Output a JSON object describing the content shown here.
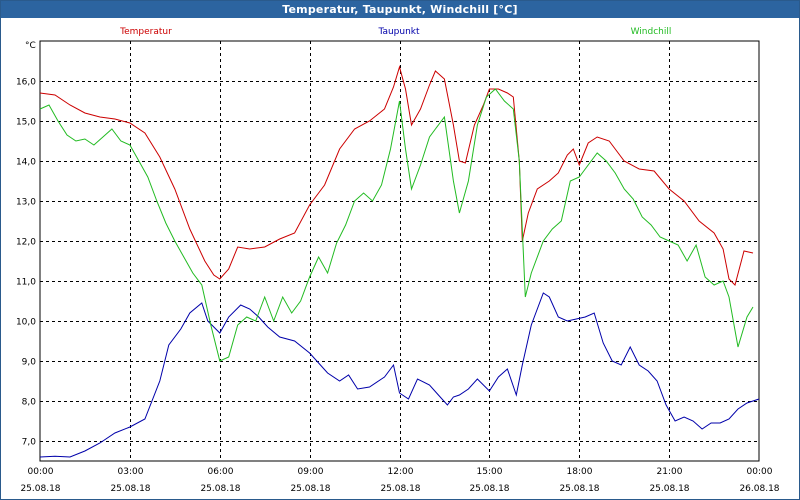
{
  "window": {
    "title": "Temperatur, Taupunkt, Windchill [°C]"
  },
  "chart_data": {
    "type": "line",
    "title": "Temperatur, Taupunkt, Windchill [°C]",
    "yunit": "°C",
    "ylim": [
      6.5,
      17.0
    ],
    "xlim": [
      0,
      24
    ],
    "grid": true,
    "y_ticks": [
      "7,0",
      "8,0",
      "9,0",
      "10,0",
      "11,0",
      "12,0",
      "13,0",
      "14,0",
      "15,0",
      "16,0"
    ],
    "y_tick_values": [
      7,
      8,
      9,
      10,
      11,
      12,
      13,
      14,
      15,
      16
    ],
    "x_ticks": [
      {
        "time": "00:00",
        "date": "25.08.18",
        "h": 0
      },
      {
        "time": "03:00",
        "date": "25.08.18",
        "h": 3
      },
      {
        "time": "06:00",
        "date": "25.08.18",
        "h": 6
      },
      {
        "time": "09:00",
        "date": "25.08.18",
        "h": 9
      },
      {
        "time": "12:00",
        "date": "25.08.18",
        "h": 12
      },
      {
        "time": "15:00",
        "date": "25.08.18",
        "h": 15
      },
      {
        "time": "18:00",
        "date": "25.08.18",
        "h": 18
      },
      {
        "time": "21:00",
        "date": "25.08.18",
        "h": 21
      },
      {
        "time": "00:00",
        "date": "26.08.18",
        "h": 24
      }
    ],
    "series": [
      {
        "name": "Temperatur",
        "color": "#cc0000",
        "points": [
          [
            0,
            15.7
          ],
          [
            0.5,
            15.65
          ],
          [
            1,
            15.4
          ],
          [
            1.5,
            15.2
          ],
          [
            2,
            15.1
          ],
          [
            2.5,
            15.05
          ],
          [
            3,
            14.95
          ],
          [
            3.5,
            14.7
          ],
          [
            4,
            14.1
          ],
          [
            4.5,
            13.3
          ],
          [
            5,
            12.3
          ],
          [
            5.5,
            11.5
          ],
          [
            5.8,
            11.15
          ],
          [
            6,
            11.05
          ],
          [
            6.3,
            11.3
          ],
          [
            6.6,
            11.85
          ],
          [
            7,
            11.8
          ],
          [
            7.5,
            11.85
          ],
          [
            8,
            12.05
          ],
          [
            8.5,
            12.2
          ],
          [
            9,
            12.9
          ],
          [
            9.5,
            13.4
          ],
          [
            10,
            14.3
          ],
          [
            10.5,
            14.8
          ],
          [
            11,
            15.0
          ],
          [
            11.5,
            15.3
          ],
          [
            11.8,
            15.85
          ],
          [
            12,
            16.35
          ],
          [
            12.2,
            15.8
          ],
          [
            12.4,
            14.9
          ],
          [
            12.7,
            15.3
          ],
          [
            13,
            15.9
          ],
          [
            13.2,
            16.25
          ],
          [
            13.5,
            16.05
          ],
          [
            13.8,
            14.9
          ],
          [
            14,
            14.0
          ],
          [
            14.2,
            13.95
          ],
          [
            14.5,
            14.9
          ],
          [
            14.8,
            15.4
          ],
          [
            15,
            15.8
          ],
          [
            15.3,
            15.8
          ],
          [
            15.6,
            15.7
          ],
          [
            15.8,
            15.6
          ],
          [
            16,
            14.0
          ],
          [
            16.1,
            12.0
          ],
          [
            16.3,
            12.7
          ],
          [
            16.6,
            13.3
          ],
          [
            17,
            13.5
          ],
          [
            17.3,
            13.7
          ],
          [
            17.6,
            14.15
          ],
          [
            17.8,
            14.3
          ],
          [
            18,
            13.9
          ],
          [
            18.3,
            14.45
          ],
          [
            18.6,
            14.6
          ],
          [
            19,
            14.5
          ],
          [
            19.5,
            14.0
          ],
          [
            20,
            13.8
          ],
          [
            20.5,
            13.75
          ],
          [
            21,
            13.3
          ],
          [
            21.5,
            13.0
          ],
          [
            22,
            12.5
          ],
          [
            22.5,
            12.2
          ],
          [
            22.8,
            11.8
          ],
          [
            23,
            11.05
          ],
          [
            23.2,
            10.9
          ],
          [
            23.5,
            11.75
          ],
          [
            23.8,
            11.7
          ]
        ]
      },
      {
        "name": "Taupunkt",
        "color": "#0000aa",
        "points": [
          [
            0,
            6.6
          ],
          [
            0.5,
            6.62
          ],
          [
            1,
            6.6
          ],
          [
            1.5,
            6.75
          ],
          [
            2,
            6.95
          ],
          [
            2.5,
            7.2
          ],
          [
            3,
            7.35
          ],
          [
            3.5,
            7.55
          ],
          [
            4,
            8.5
          ],
          [
            4.3,
            9.4
          ],
          [
            4.7,
            9.8
          ],
          [
            5,
            10.2
          ],
          [
            5.4,
            10.45
          ],
          [
            5.6,
            10.0
          ],
          [
            6,
            9.7
          ],
          [
            6.3,
            10.1
          ],
          [
            6.7,
            10.4
          ],
          [
            7,
            10.3
          ],
          [
            7.3,
            10.1
          ],
          [
            7.6,
            9.85
          ],
          [
            8,
            9.6
          ],
          [
            8.5,
            9.5
          ],
          [
            9,
            9.2
          ],
          [
            9.3,
            8.95
          ],
          [
            9.6,
            8.7
          ],
          [
            10,
            8.5
          ],
          [
            10.3,
            8.65
          ],
          [
            10.6,
            8.3
          ],
          [
            11,
            8.35
          ],
          [
            11.5,
            8.6
          ],
          [
            11.8,
            8.9
          ],
          [
            12,
            8.2
          ],
          [
            12.3,
            8.05
          ],
          [
            12.6,
            8.55
          ],
          [
            13,
            8.4
          ],
          [
            13.3,
            8.15
          ],
          [
            13.6,
            7.9
          ],
          [
            13.8,
            8.1
          ],
          [
            14,
            8.15
          ],
          [
            14.3,
            8.3
          ],
          [
            14.6,
            8.55
          ],
          [
            15,
            8.25
          ],
          [
            15.3,
            8.6
          ],
          [
            15.6,
            8.8
          ],
          [
            15.9,
            8.15
          ],
          [
            16.1,
            8.9
          ],
          [
            16.4,
            9.9
          ],
          [
            16.8,
            10.7
          ],
          [
            17,
            10.6
          ],
          [
            17.3,
            10.1
          ],
          [
            17.6,
            10.0
          ],
          [
            17.9,
            10.05
          ],
          [
            18.2,
            10.1
          ],
          [
            18.5,
            10.2
          ],
          [
            18.8,
            9.45
          ],
          [
            19.1,
            9.0
          ],
          [
            19.4,
            8.9
          ],
          [
            19.7,
            9.35
          ],
          [
            20,
            8.9
          ],
          [
            20.3,
            8.75
          ],
          [
            20.6,
            8.5
          ],
          [
            20.9,
            7.9
          ],
          [
            21.2,
            7.5
          ],
          [
            21.5,
            7.6
          ],
          [
            21.8,
            7.5
          ],
          [
            22.1,
            7.3
          ],
          [
            22.4,
            7.45
          ],
          [
            22.7,
            7.45
          ],
          [
            23,
            7.55
          ],
          [
            23.3,
            7.8
          ],
          [
            23.6,
            7.95
          ],
          [
            24,
            8.05
          ]
        ]
      },
      {
        "name": "Windchill",
        "color": "#22bb22",
        "points": [
          [
            0,
            15.3
          ],
          [
            0.3,
            15.4
          ],
          [
            0.6,
            15.0
          ],
          [
            0.9,
            14.65
          ],
          [
            1.2,
            14.5
          ],
          [
            1.5,
            14.55
          ],
          [
            1.8,
            14.4
          ],
          [
            2.1,
            14.6
          ],
          [
            2.4,
            14.8
          ],
          [
            2.7,
            14.5
          ],
          [
            3,
            14.4
          ],
          [
            3.3,
            14.0
          ],
          [
            3.6,
            13.6
          ],
          [
            3.9,
            13.0
          ],
          [
            4.2,
            12.45
          ],
          [
            4.5,
            12.0
          ],
          [
            4.8,
            11.6
          ],
          [
            5.1,
            11.2
          ],
          [
            5.4,
            10.9
          ],
          [
            5.7,
            9.9
          ],
          [
            6,
            9.0
          ],
          [
            6.3,
            9.1
          ],
          [
            6.6,
            9.9
          ],
          [
            6.9,
            10.1
          ],
          [
            7.2,
            10.0
          ],
          [
            7.5,
            10.6
          ],
          [
            7.8,
            10.0
          ],
          [
            8.1,
            10.6
          ],
          [
            8.4,
            10.2
          ],
          [
            8.7,
            10.5
          ],
          [
            9,
            11.1
          ],
          [
            9.3,
            11.6
          ],
          [
            9.6,
            11.2
          ],
          [
            9.9,
            11.95
          ],
          [
            10.2,
            12.4
          ],
          [
            10.5,
            13.0
          ],
          [
            10.8,
            13.2
          ],
          [
            11.1,
            13.0
          ],
          [
            11.4,
            13.4
          ],
          [
            11.7,
            14.3
          ],
          [
            12,
            15.5
          ],
          [
            12.2,
            14.3
          ],
          [
            12.4,
            13.3
          ],
          [
            12.7,
            13.9
          ],
          [
            13,
            14.6
          ],
          [
            13.2,
            14.8
          ],
          [
            13.5,
            15.1
          ],
          [
            13.8,
            13.5
          ],
          [
            14,
            12.7
          ],
          [
            14.3,
            13.5
          ],
          [
            14.6,
            14.9
          ],
          [
            14.9,
            15.6
          ],
          [
            15.2,
            15.8
          ],
          [
            15.5,
            15.5
          ],
          [
            15.8,
            15.3
          ],
          [
            16,
            14.0
          ],
          [
            16.2,
            10.6
          ],
          [
            16.4,
            11.2
          ],
          [
            16.8,
            12.0
          ],
          [
            17.1,
            12.3
          ],
          [
            17.4,
            12.5
          ],
          [
            17.7,
            13.5
          ],
          [
            18,
            13.6
          ],
          [
            18.3,
            13.9
          ],
          [
            18.6,
            14.2
          ],
          [
            18.9,
            14.0
          ],
          [
            19.2,
            13.7
          ],
          [
            19.5,
            13.3
          ],
          [
            19.8,
            13.05
          ],
          [
            20.1,
            12.6
          ],
          [
            20.4,
            12.4
          ],
          [
            20.7,
            12.1
          ],
          [
            21,
            12.0
          ],
          [
            21.3,
            11.9
          ],
          [
            21.6,
            11.5
          ],
          [
            21.9,
            11.9
          ],
          [
            22.2,
            11.1
          ],
          [
            22.5,
            10.9
          ],
          [
            22.8,
            11.0
          ],
          [
            23,
            10.6
          ],
          [
            23.3,
            9.35
          ],
          [
            23.6,
            10.1
          ],
          [
            23.8,
            10.35
          ]
        ]
      }
    ]
  }
}
